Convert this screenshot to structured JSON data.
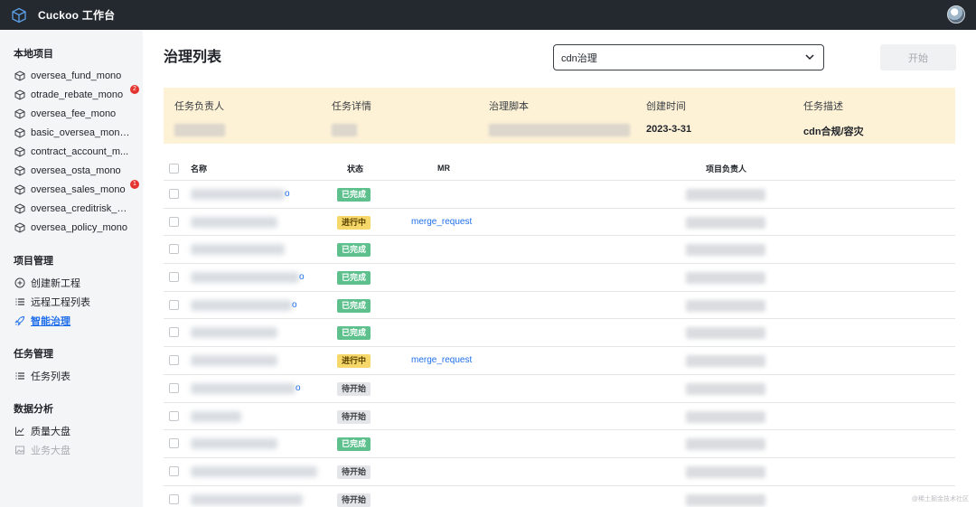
{
  "app": {
    "title": "Cuckoo 工作台"
  },
  "sidebar": {
    "local_projects": {
      "title": "本地项目",
      "items": [
        {
          "label": "oversea_fund_mono"
        },
        {
          "label": "otrade_rebate_mono",
          "badge": "2"
        },
        {
          "label": "oversea_fee_mono"
        },
        {
          "label": "basic_oversea_mono..."
        },
        {
          "label": "contract_account_m..."
        },
        {
          "label": "oversea_osta_mono"
        },
        {
          "label": "oversea_sales_mono",
          "badge": "1"
        },
        {
          "label": "oversea_creditrisk_m..."
        },
        {
          "label": "oversea_policy_mono"
        }
      ]
    },
    "project_mgmt": {
      "title": "项目管理",
      "items": [
        {
          "label": "创建新工程",
          "icon": "plus-circle-icon"
        },
        {
          "label": "远程工程列表",
          "icon": "list-icon"
        },
        {
          "label": "智能治理",
          "icon": "rocket-icon",
          "active": true
        }
      ]
    },
    "task_mgmt": {
      "title": "任务管理",
      "items": [
        {
          "label": "任务列表",
          "icon": "list-icon"
        }
      ]
    },
    "data_analysis": {
      "title": "数据分析",
      "items": [
        {
          "label": "质量大盘",
          "icon": "line-chart-icon"
        },
        {
          "label": "业务大盘",
          "icon": "image-icon",
          "disabled": true
        }
      ]
    }
  },
  "main": {
    "title": "治理列表",
    "select": {
      "value": "cdn治理"
    },
    "start_button": "开始",
    "info": {
      "owner_label": "任务负责人",
      "detail_label": "任务详情",
      "script_label": "治理脚本",
      "created_label": "创建时间",
      "created_value": "2023-3-31",
      "desc_label": "任务描述",
      "desc_value": "cdn合规/容灾"
    },
    "table": {
      "headers": {
        "name": "名称",
        "status": "状态",
        "mr": "MR",
        "owner": "项目负责人"
      },
      "rows": [
        {
          "status": "已完成",
          "kind": "done",
          "mr": "",
          "tail": "o"
        },
        {
          "status": "进行中",
          "kind": "doing",
          "mr": "merge_request",
          "tail": ""
        },
        {
          "status": "已完成",
          "kind": "done",
          "mr": "",
          "tail": ""
        },
        {
          "status": "已完成",
          "kind": "done",
          "mr": "",
          "tail": "o"
        },
        {
          "status": "已完成",
          "kind": "done",
          "mr": "",
          "tail": "o"
        },
        {
          "status": "已完成",
          "kind": "done",
          "mr": "",
          "tail": ""
        },
        {
          "status": "进行中",
          "kind": "doing",
          "mr": "merge_request",
          "tail": ""
        },
        {
          "status": "待开始",
          "kind": "todo",
          "mr": "",
          "tail": "o"
        },
        {
          "status": "待开始",
          "kind": "todo",
          "mr": "",
          "tail": ""
        },
        {
          "status": "已完成",
          "kind": "done",
          "mr": "",
          "tail": ""
        },
        {
          "status": "待开始",
          "kind": "todo",
          "mr": "",
          "tail": ""
        },
        {
          "status": "待开始",
          "kind": "todo",
          "mr": "",
          "tail": ""
        }
      ]
    }
  },
  "watermark": "@稀土掘金技术社区"
}
